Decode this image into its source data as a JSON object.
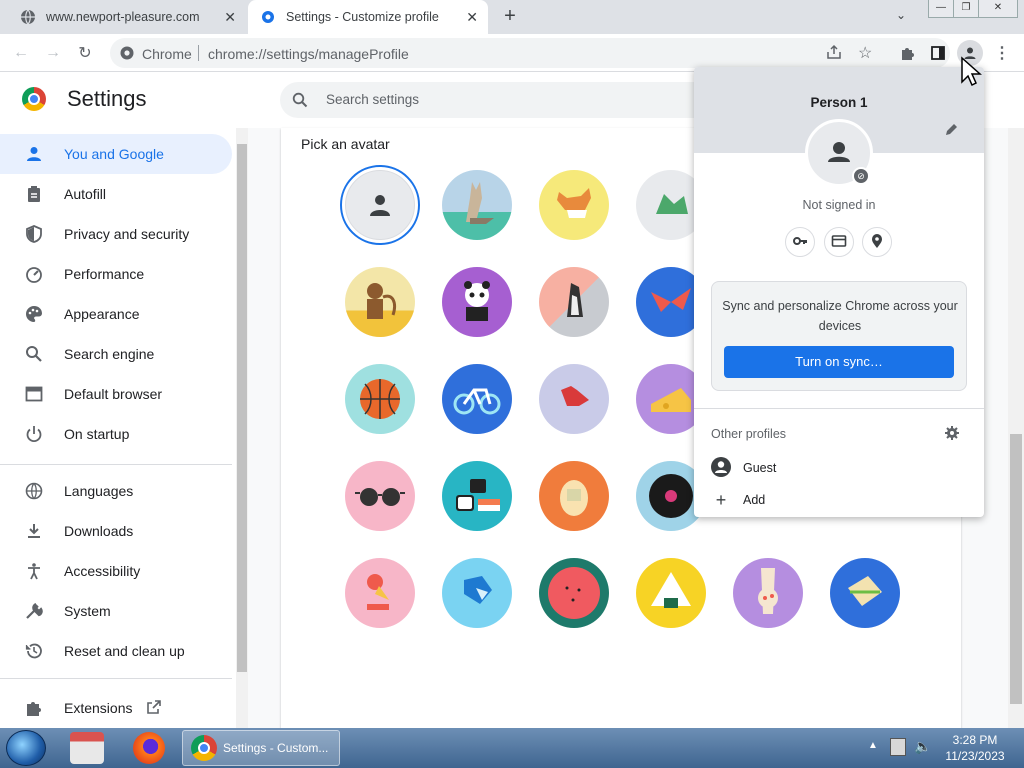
{
  "tabs": [
    {
      "title": "www.newport-pleasure.com",
      "close": "✕"
    },
    {
      "title": "Settings - Customize profile",
      "close": "✕"
    }
  ],
  "new_tab_label": "+",
  "tab_dropdown": "⌄",
  "window_buttons": {
    "min": "—",
    "max": "❐",
    "close": "✕"
  },
  "omnibox": {
    "site_label": "Chrome",
    "url": "chrome://settings/manageProfile"
  },
  "settings": {
    "title": "Settings",
    "search_placeholder": "Search settings"
  },
  "sidebar": {
    "items": [
      {
        "label": "You and Google",
        "icon": "person-icon",
        "active": true
      },
      {
        "label": "Autofill",
        "icon": "clipboard-icon"
      },
      {
        "label": "Privacy and security",
        "icon": "shield-icon"
      },
      {
        "label": "Performance",
        "icon": "speedometer-icon"
      },
      {
        "label": "Appearance",
        "icon": "palette-icon"
      },
      {
        "label": "Search engine",
        "icon": "search-icon"
      },
      {
        "label": "Default browser",
        "icon": "browser-icon"
      },
      {
        "label": "On startup",
        "icon": "power-icon"
      },
      {
        "label": "Languages",
        "icon": "globe-icon"
      },
      {
        "label": "Downloads",
        "icon": "download-icon"
      },
      {
        "label": "Accessibility",
        "icon": "accessibility-icon"
      },
      {
        "label": "System",
        "icon": "wrench-icon"
      },
      {
        "label": "Reset and clean up",
        "icon": "history-icon"
      },
      {
        "label": "Extensions",
        "icon": "puzzle-icon"
      }
    ]
  },
  "main": {
    "pick_avatar_label": "Pick an avatar",
    "avatars": [
      [
        "default-person",
        "cat",
        "corgi",
        "dragon"
      ],
      [
        "monkey",
        "panda",
        "penguin",
        "butterfly"
      ],
      [
        "basketball",
        "bicycle",
        "bird",
        "cheese"
      ],
      [
        "sunglasses",
        "sushi",
        "tamagotchi",
        "vinyl-record"
      ],
      [
        "ice-cream",
        "origami",
        "watermelon",
        "onigiri",
        "pizza",
        "sandwich"
      ]
    ]
  },
  "profile_popup": {
    "name": "Person 1",
    "status": "Not signed in",
    "sync_text": "Sync and personalize Chrome across your devices",
    "sync_button": "Turn on sync…",
    "other_profiles": "Other profiles",
    "guest": "Guest",
    "add": "Add"
  },
  "taskbar": {
    "chrome_task": "Settings - Custom...",
    "time": "3:28 PM",
    "date": "11/23/2023"
  }
}
